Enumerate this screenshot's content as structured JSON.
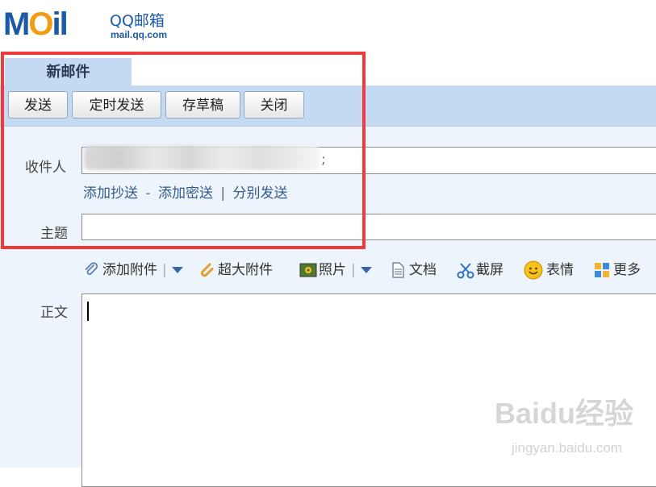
{
  "logo": {
    "mark": "MOil",
    "brand": "QQ邮箱",
    "url": "mail.qq.com"
  },
  "tab": {
    "label": "新邮件"
  },
  "toolbar": {
    "send": "发送",
    "scheduled_send": "定时发送",
    "save_draft": "存草稿",
    "close": "关闭"
  },
  "recipient": {
    "label": "收件人",
    "separator": ";"
  },
  "links": {
    "add_cc": "添加抄送",
    "dash": "-",
    "add_bcc": "添加密送",
    "pipe": "|",
    "separate_send": "分别发送"
  },
  "subject": {
    "label": "主题",
    "value": ""
  },
  "attachments": {
    "add_attachment": "添加附件",
    "large_attachment": "超大附件",
    "photo": "照片",
    "document": "文档",
    "screenshot": "截屏",
    "emoji": "表情",
    "more": "更多"
  },
  "body": {
    "label": "正文",
    "value": ""
  },
  "watermark": {
    "text": "Baidu经验",
    "url": "jingyan.baidu.com"
  },
  "colors": {
    "accent_blue": "#c4daf3",
    "highlight_red": "#ee3b3b",
    "link": "#335a8a"
  }
}
